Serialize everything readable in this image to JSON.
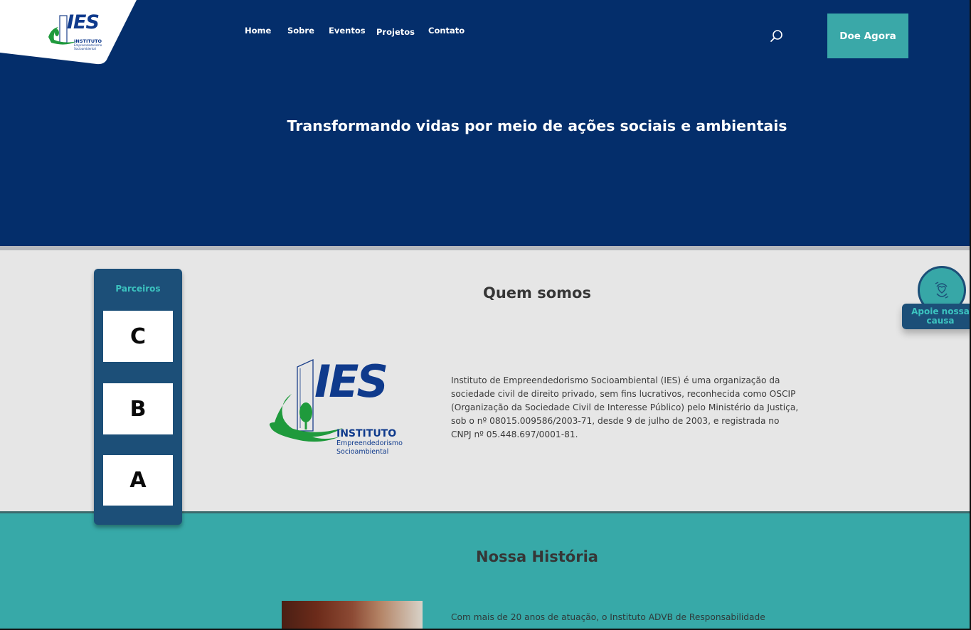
{
  "header": {
    "logo": {
      "mark": "IES",
      "line1": "INSTITUTO",
      "line2": "Empreendedorismo",
      "line3": "Socioambiental"
    },
    "nav": [
      {
        "label": "Home"
      },
      {
        "label": "Sobre"
      },
      {
        "label": "Eventos"
      },
      {
        "label": "Projetos"
      },
      {
        "label": "Contato"
      }
    ],
    "search_icon": "search-icon",
    "donate_label": "Doe Agora"
  },
  "hero": {
    "title": "Transformando vidas por meio de ações sociais e ambientais"
  },
  "partners": {
    "title": "Parceiros",
    "items": [
      {
        "label": "C"
      },
      {
        "label": "B"
      },
      {
        "label": "A"
      }
    ]
  },
  "about": {
    "title": "Quem somos",
    "logo": {
      "mark": "IES",
      "line1": "INSTITUTO",
      "line2": "Empreendedorismo",
      "line3": "Socioambiental"
    },
    "text": "Instituto de Empreendedorismo Socioambiental (IES) é uma organização da sociedade civil de direito privado, sem fins lucrativos, reconhecida como OSCIP (Organização da Sociedade Civil de Interesse Público) pelo Ministério da Justiça, sob o nº 08015.009586/2003-71, desde 9 de julho de 2003, e registrada no CNPJ nº 05.448.697/0001-81."
  },
  "support": {
    "label": "Apoie nossa causa",
    "icon": "hands-heart-icon"
  },
  "history": {
    "title": "Nossa História",
    "text": "Com mais de 20 anos de atuação, o Instituto ADVB de Responsabilidade"
  },
  "colors": {
    "navy": "#042e6b",
    "teal": "#3aa8a8",
    "panel": "#1c4f78",
    "accent_teal_text": "#3cc4c0",
    "light_bg": "#e6e6e6"
  }
}
